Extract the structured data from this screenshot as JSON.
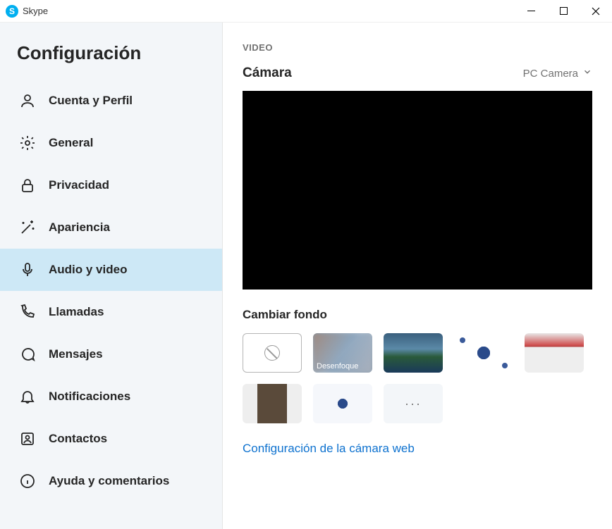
{
  "window": {
    "title": "Skype"
  },
  "sidebar": {
    "title": "Configuración",
    "items": [
      {
        "label": "Cuenta y Perfil"
      },
      {
        "label": "General"
      },
      {
        "label": "Privacidad"
      },
      {
        "label": "Apariencia"
      },
      {
        "label": "Audio y video"
      },
      {
        "label": "Llamadas"
      },
      {
        "label": "Mensajes"
      },
      {
        "label": "Notificaciones"
      },
      {
        "label": "Contactos"
      },
      {
        "label": "Ayuda y comentarios"
      }
    ],
    "activeIndex": 4
  },
  "main": {
    "section_label": "VIDEO",
    "camera_label": "Cámara",
    "camera_selected": "PC Camera",
    "change_bg_label": "Cambiar fondo",
    "bg_tiles": {
      "blur_caption": "Desenfoque",
      "more_label": "···"
    },
    "webcam_settings_link": "Configuración de la cámara web"
  }
}
